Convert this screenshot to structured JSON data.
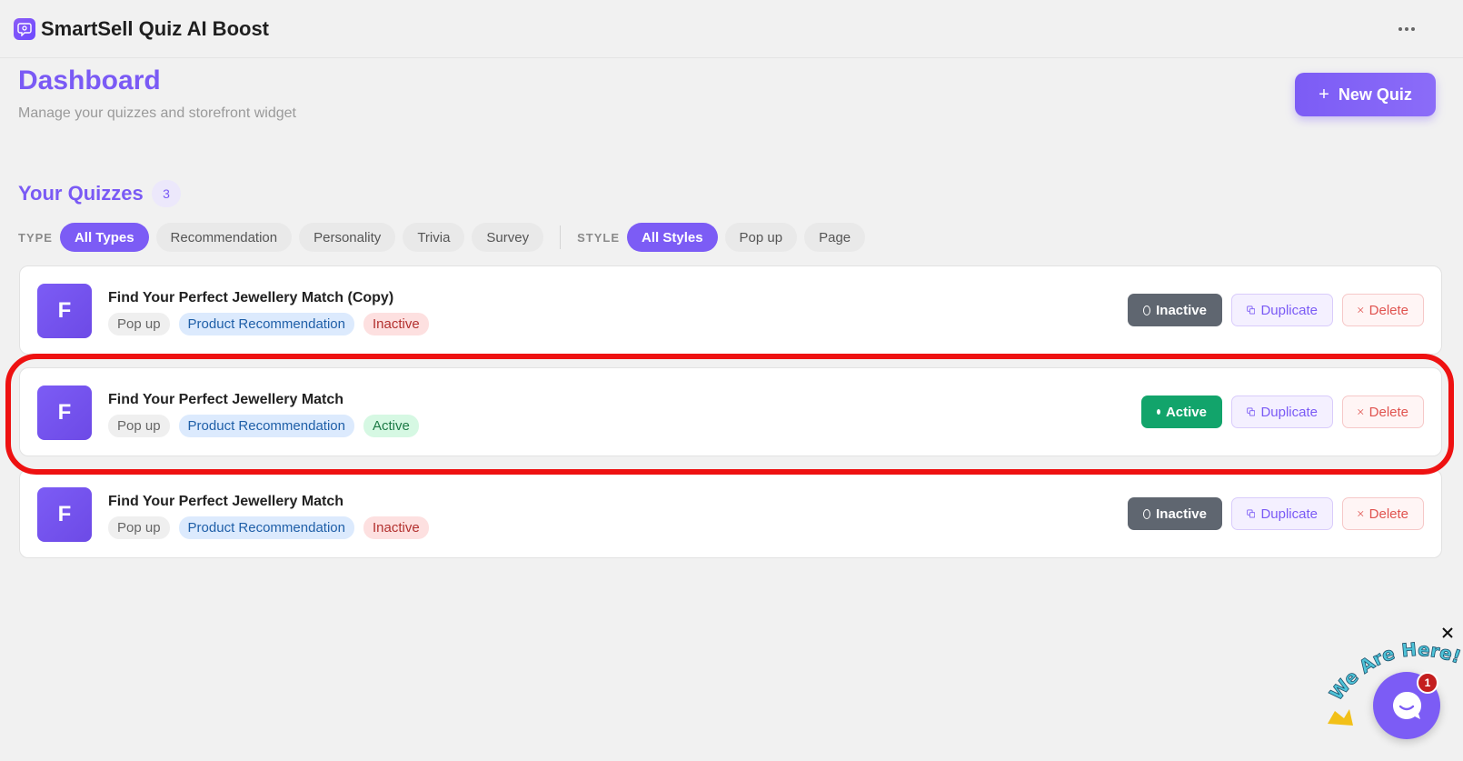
{
  "app": {
    "title": "SmartSell Quiz AI Boost"
  },
  "header": {
    "title": "Dashboard",
    "subtitle": "Manage your quizzes and storefront widget",
    "new_quiz_label": "New Quiz",
    "new_quiz_icon": "plus-icon"
  },
  "quizzes_section": {
    "title": "Your Quizzes",
    "count": "3"
  },
  "filters": {
    "type_label": "TYPE",
    "types": [
      {
        "label": "All Types",
        "selected": true
      },
      {
        "label": "Recommendation",
        "selected": false
      },
      {
        "label": "Personality",
        "selected": false
      },
      {
        "label": "Trivia",
        "selected": false
      },
      {
        "label": "Survey",
        "selected": false
      }
    ],
    "style_label": "STYLE",
    "styles": [
      {
        "label": "All Styles",
        "selected": true
      },
      {
        "label": "Pop up",
        "selected": false
      },
      {
        "label": "Page",
        "selected": false
      }
    ]
  },
  "quizzes": [
    {
      "initial": "F",
      "name": "Find Your Perfect Jewellery Match (Copy)",
      "style_tag": "Pop up",
      "type_tag": "Product Recommendation",
      "status": "Inactive",
      "toggle_label": "Inactive",
      "duplicate_label": "Duplicate",
      "delete_label": "Delete"
    },
    {
      "initial": "F",
      "name": "Find Your Perfect Jewellery Match",
      "style_tag": "Pop up",
      "type_tag": "Product Recommendation",
      "status": "Active",
      "toggle_label": "Active",
      "duplicate_label": "Duplicate",
      "delete_label": "Delete"
    },
    {
      "initial": "F",
      "name": "Find Your Perfect Jewellery Match",
      "style_tag": "Pop up",
      "type_tag": "Product Recommendation",
      "status": "Inactive",
      "toggle_label": "Inactive",
      "duplicate_label": "Duplicate",
      "delete_label": "Delete"
    }
  ],
  "chat_widget": {
    "caption": "We Are Here!",
    "notification_count": "1"
  },
  "colors": {
    "accent": "#7c5cf5",
    "active": "#12a46b",
    "inactive": "#5f6670",
    "danger": "#e0534f",
    "highlight": "#ee1111"
  }
}
